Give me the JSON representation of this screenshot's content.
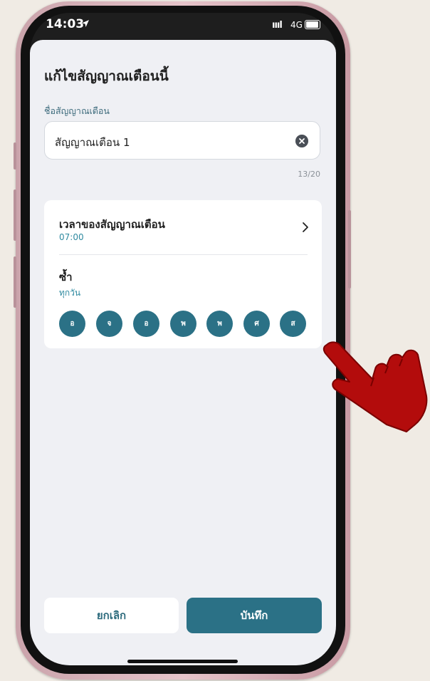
{
  "status_bar": {
    "time": "14:03",
    "network": "4G",
    "signal_glyph": "ıııl"
  },
  "sheet": {
    "title": "แก้ไขสัญญาณเตือนนี้",
    "name_field": {
      "label": "ชื่อสัญญาณเตือน",
      "value": "สัญญาณเตือน 1",
      "char_count": "13/20"
    },
    "alarm_time": {
      "label": "เวลาของสัญญาณเตือน",
      "value": "07:00"
    },
    "repeat": {
      "label": "ซ้ำ",
      "value": "ทุกวัน",
      "days": [
        "อ",
        "จ",
        "อ",
        "พ",
        "พ",
        "ศ",
        "ส"
      ]
    },
    "buttons": {
      "cancel": "ยกเลิก",
      "save": "บันทึก"
    }
  },
  "colors": {
    "accent": "#2b7186",
    "link": "#2f8aa0",
    "sheet_bg": "#eff0f4",
    "pointer_hand": "#b30c0c"
  },
  "icons": [
    "location-arrow-icon",
    "battery-icon",
    "clear-icon",
    "chevron-right-icon",
    "pointing-hand-icon"
  ]
}
